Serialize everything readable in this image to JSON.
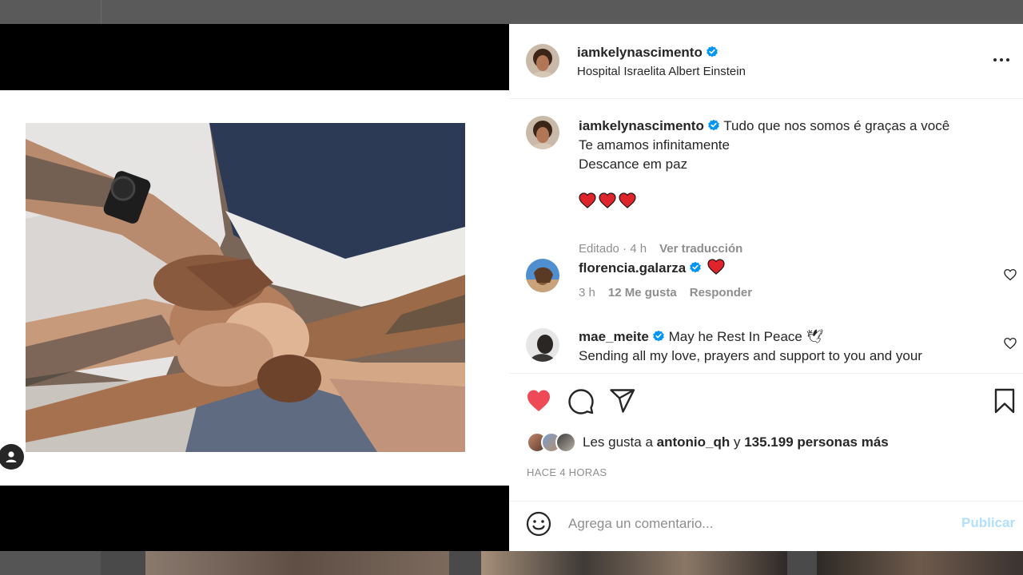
{
  "post": {
    "author": "iamkelynascimento",
    "location": "Hospital Israelita Albert Einstein"
  },
  "caption": {
    "author": "iamkelynascimento",
    "line1": "Tudo que nos somos é graças a você",
    "line2": "Te amamos infinitamente",
    "line3": "Descance em paz",
    "emoji": "❤️❤️❤️",
    "edited": "Editado · 4 h",
    "translate": "Ver traducción"
  },
  "comments": [
    {
      "author": "florencia.galarza",
      "text": "❤️",
      "time": "3 h",
      "likes": "12 Me gusta",
      "reply": "Responder"
    },
    {
      "author": "mae_meite",
      "text": "May he Rest In Peace 🕊",
      "text2": "Sending all my love, prayers and support to you and your"
    }
  ],
  "likes": {
    "prefix": "Les gusta a",
    "user": "antonio_qh",
    "conj": "y",
    "count": "135.199 personas más"
  },
  "timestamp": "HACE 4 HORAS",
  "composer": {
    "placeholder": "Agrega un comentario...",
    "publish": "Publicar"
  },
  "icons": {
    "verified": "verified-badge-icon",
    "like": "heart-filled-icon",
    "comment": "comment-bubble-icon",
    "share": "paper-plane-icon",
    "save": "bookmark-icon",
    "more": "more-horizontal-icon",
    "emoji": "smiley-icon"
  },
  "colors": {
    "like_red": "#ed4956",
    "verified_blue": "#0095f6",
    "publish_disabled": "#b2dffc",
    "text": "#262626",
    "muted": "#8e8e8e"
  }
}
